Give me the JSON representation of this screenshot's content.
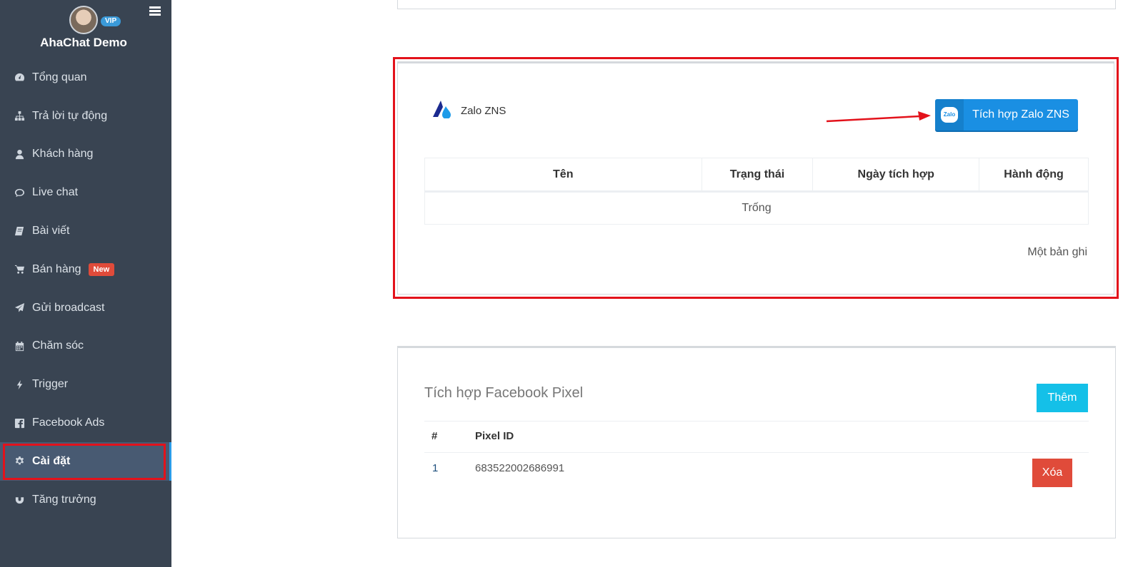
{
  "profile": {
    "name": "AhaChat Demo",
    "badge": "VIP"
  },
  "nav": [
    {
      "label": "Tổng quan",
      "icon": "dashboard-icon"
    },
    {
      "label": "Trả lời tự động",
      "icon": "sitemap-icon"
    },
    {
      "label": "Khách hàng",
      "icon": "user-icon"
    },
    {
      "label": "Live chat",
      "icon": "chat-bubble-icon"
    },
    {
      "label": "Bài viết",
      "icon": "book-icon"
    },
    {
      "label": "Bán hàng",
      "icon": "cart-icon",
      "badge": "New"
    },
    {
      "label": "Gửi broadcast",
      "icon": "paper-plane-icon"
    },
    {
      "label": "Chăm sóc",
      "icon": "calendar-icon"
    },
    {
      "label": "Trigger",
      "icon": "bolt-icon"
    },
    {
      "label": "Facebook Ads",
      "icon": "facebook-square-icon"
    },
    {
      "label": "Cài đặt",
      "icon": "gear-icon",
      "active": true
    },
    {
      "label": "Tăng trưởng",
      "icon": "magnet-icon"
    }
  ],
  "zalo": {
    "title": "Zalo ZNS",
    "button_label": "Tích hợp Zalo ZNS",
    "button_icon_text": "Zalo",
    "columns": [
      "Tên",
      "Trạng thái",
      "Ngày tích hợp",
      "Hành động"
    ],
    "empty_text": "Trống",
    "record_count": "Một bản ghi"
  },
  "pixel": {
    "title": "Tích hợp Facebook Pixel",
    "add_label": "Thêm",
    "col_num": "#",
    "col_id": "Pixel ID",
    "rows": [
      {
        "num": "1",
        "id": "683522002686991",
        "delete_label": "Xóa"
      }
    ]
  },
  "colors": {
    "sidebar": "#394452",
    "active": "#485a72",
    "highlight": "#e3121b",
    "zalo_button": "#1a8fe3",
    "add_button": "#14c0e8",
    "delete_button": "#e04b3a"
  }
}
